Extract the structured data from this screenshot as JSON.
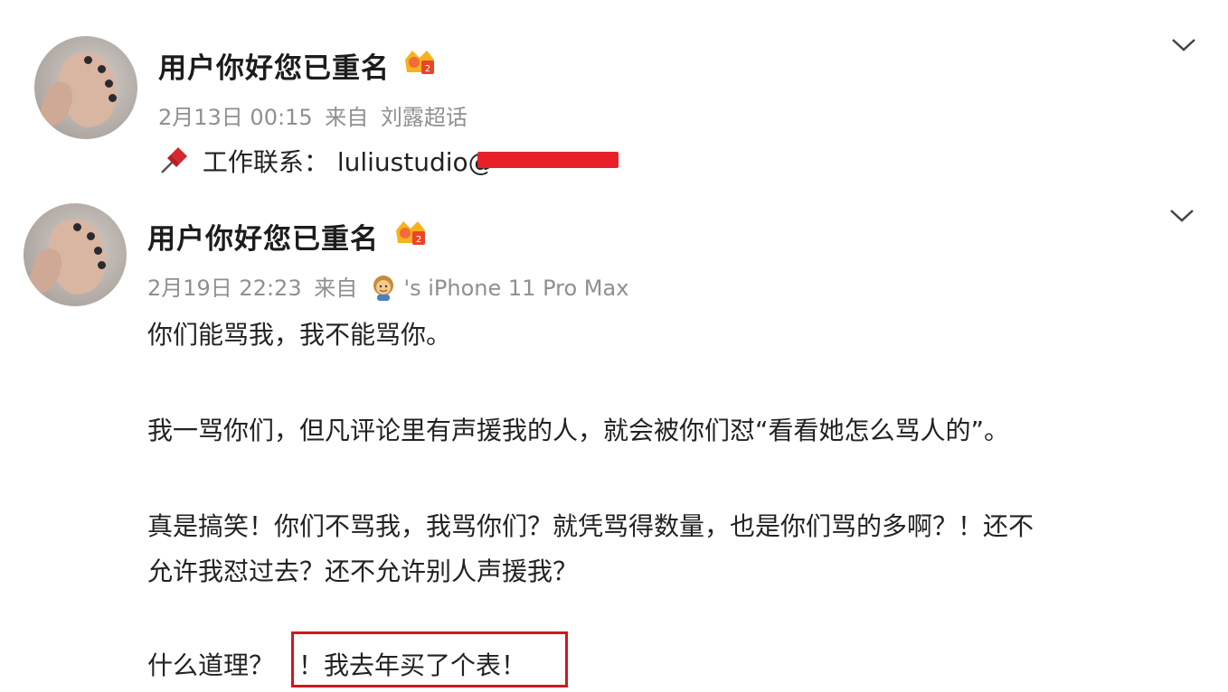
{
  "posts": [
    {
      "username": "用户你好您已重名",
      "date": "2月13日 00:15",
      "source_prefix": "来自",
      "source": "刘露超话",
      "contact_label": "工作联系：",
      "contact_value": "luliustudio@",
      "icons": {
        "badge": "member-crown-icon",
        "pin": "pushpin-icon",
        "menu": "chevron-down-icon"
      }
    },
    {
      "username": "用户你好您已重名",
      "date": "2月19日 22:23",
      "source_prefix": "来自",
      "device": "'s iPhone 11 Pro Max",
      "icons": {
        "badge": "member-crown-icon",
        "device_emoji": "woman-emoji-icon",
        "menu": "chevron-down-icon"
      },
      "paragraphs": [
        "你们能骂我，我不能骂你。",
        "我一骂你们，但凡评论里有声援我的人，就会被你们怼“看看她怎么骂人的”。",
        "真是搞笑！你们不骂我，我骂你们？就凭骂得数量，也是你们骂的多啊？！还不",
        "允许我怼过去？还不允许别人声援我？",
        "什么道理？",
        "！我去年买了个表！"
      ]
    }
  ],
  "colors": {
    "highlight_border": "#d4151f",
    "redaction": "#e8202a",
    "meta_text": "#8f8f8f"
  }
}
